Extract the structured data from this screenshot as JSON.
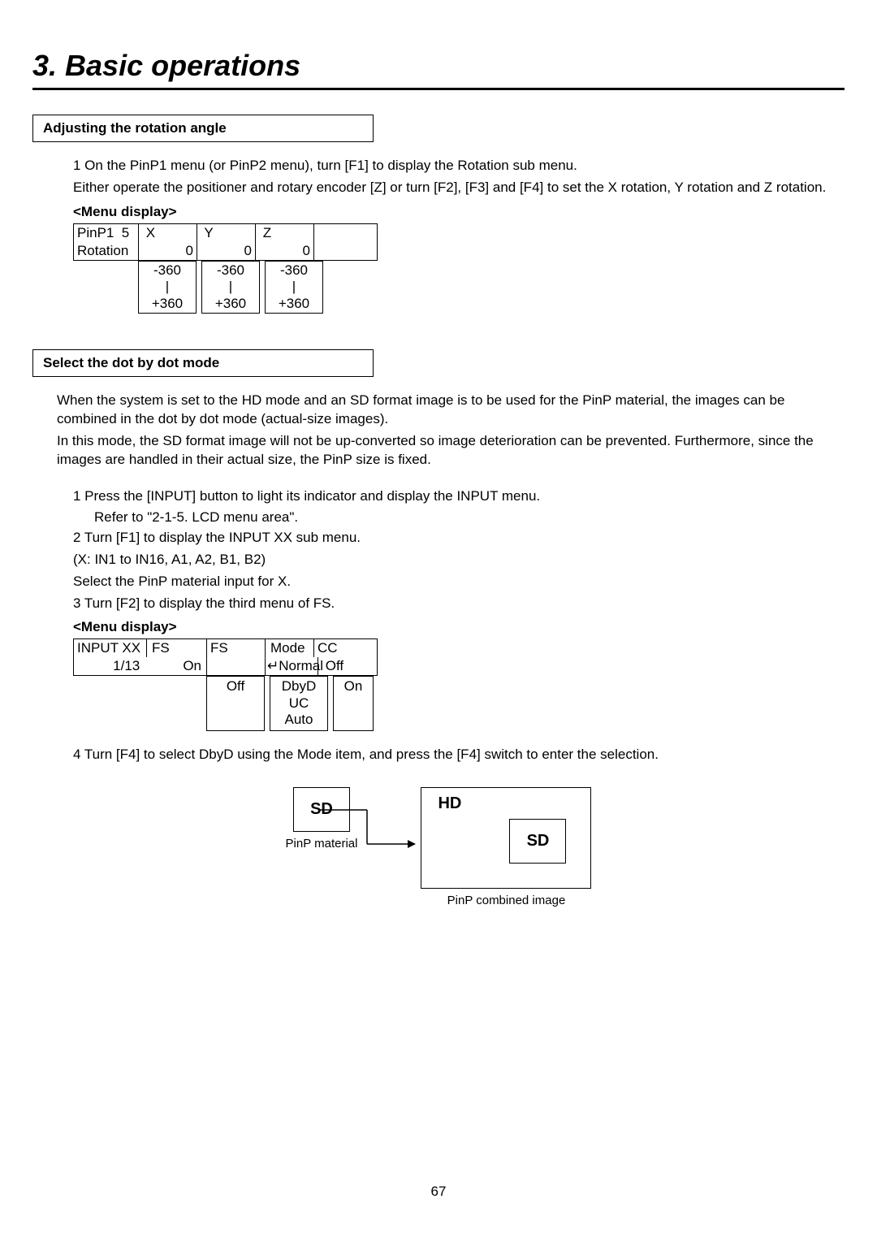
{
  "chapter_title": "3. Basic operations",
  "section1": {
    "title": "Adjusting the rotation angle",
    "para1": "1 On the PinP1 menu (or PinP2 menu), turn [F1] to display the Rotation sub menu.",
    "para2": "Either operate the positioner and rotary encoder [Z] or turn [F2], [F3] and [F4] to set the X rotation, Y rotation and Z rotation.",
    "menu_label": "<Menu display>",
    "menu_row1": {
      "c1": "PinP1  5",
      "c2": " X",
      "c3": " Y",
      "c4": " Z",
      "c5": ""
    },
    "menu_row2": {
      "c1": "Rotation",
      "c2": "0",
      "c3": "0",
      "c4": "0",
      "c5": ""
    },
    "range": {
      "min": "-360",
      "bar": "|",
      "max": "+360"
    }
  },
  "section2": {
    "title": "Select the dot by dot mode",
    "para1": "When the system is set to the HD mode and an SD format image is to be used for the PinP material, the images can be combined in the dot by dot mode (actual-size images).",
    "para2": "In this mode, the SD format image will not be up-converted so image deterioration can be prevented. Furthermore, since the images are handled in their actual size, the PinP size is fixed.",
    "step1a": "1 Press the [INPUT] button to light its indicator and display the INPUT menu.",
    "step1b": "Refer to \"2-1-5. LCD menu area\".",
    "step2a": "2 Turn [F1] to display the INPUT XX sub menu.",
    "step2b": "(X: IN1 to IN16, A1, A2, B1, B2)",
    "step2c": "Select the PinP material input for X.",
    "step3": "3 Turn [F2] to display the third menu of FS.",
    "menu_label": "<Menu display>",
    "menu_row1": {
      "c1": "INPUT XX",
      "c2": " FS",
      "c3": " FS",
      "c4": " Mode",
      "c5": " CC"
    },
    "menu_row2": {
      "c1": " 1/13 ",
      "c2": "On",
      "c3": "",
      "c4": "↵Normal",
      "c5": " Off"
    },
    "options": {
      "fs": "Off",
      "mode": [
        "DbyD",
        "UC",
        "Auto"
      ],
      "cc": "On"
    },
    "step4": "4 Turn [F4] to select DbyD using the Mode item, and press the [F4] switch to enter the selection.",
    "diagram": {
      "sd_box": "SD",
      "pinp_material": "PinP material",
      "hd_label": "HD",
      "sd_inner": "SD",
      "combined": "PinP combined image"
    }
  },
  "page_number": "67"
}
